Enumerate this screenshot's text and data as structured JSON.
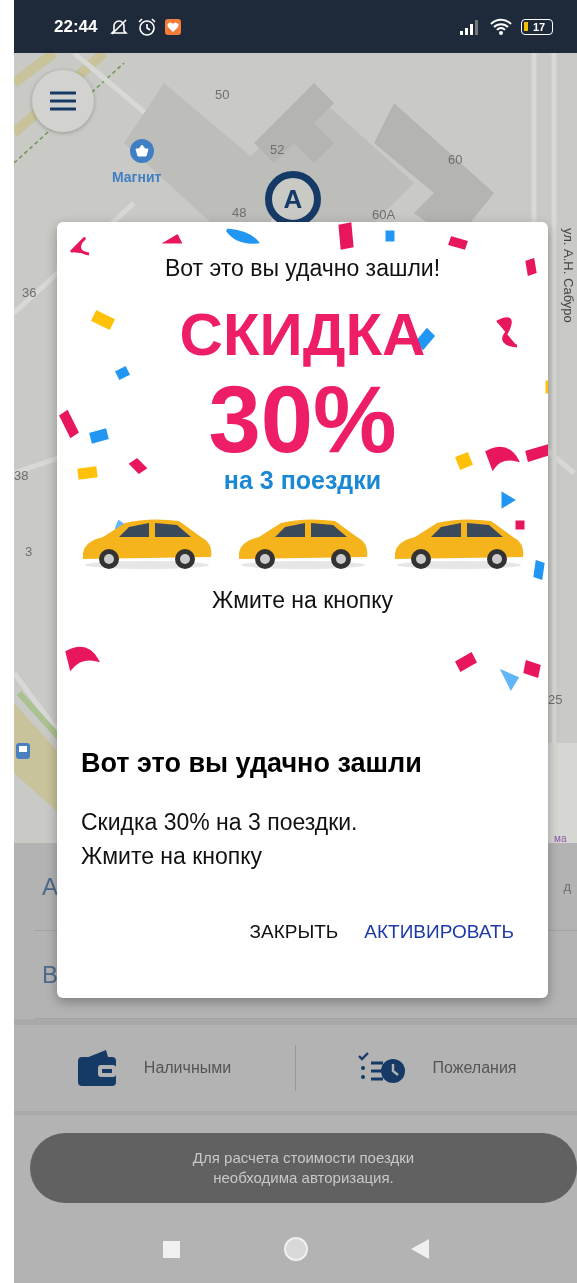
{
  "status_bar": {
    "time": "22:44",
    "battery": "17"
  },
  "map": {
    "labels": [
      "50",
      "52",
      "60",
      "48",
      "60А",
      "36",
      "38",
      "3",
      "25"
    ],
    "poi": "Магнит",
    "pin": "А",
    "street": "ул. А.Н. Сабуро",
    "edge_text": "ма"
  },
  "panel": {
    "rows": [
      {
        "label": "А",
        "hint": "д"
      },
      {
        "label": "В",
        "hint": ""
      }
    ],
    "options": [
      {
        "kind": "payment",
        "label": "Наличными"
      },
      {
        "kind": "wishes",
        "label": "Пожелания"
      }
    ]
  },
  "toast": {
    "lines": [
      "Для расчета стоимости поездки",
      "необходима авторизация."
    ]
  },
  "dialog": {
    "banner": {
      "heading": "Вот это вы удачно зашли!",
      "promo": "СКИДКА",
      "discount": "30%",
      "subtitle": "на 3 поездки",
      "cta": "Жмите на кнопку"
    },
    "title": "Вот это вы удачно зашли",
    "message": [
      "Скидка 30% на 3 поездки.",
      "Жмите на кнопку"
    ],
    "buttons": [
      {
        "kind": "dismiss",
        "label": "ЗАКРЫТЬ"
      },
      {
        "kind": "primary",
        "label": "АКТИВИРОВАТЬ"
      }
    ]
  }
}
